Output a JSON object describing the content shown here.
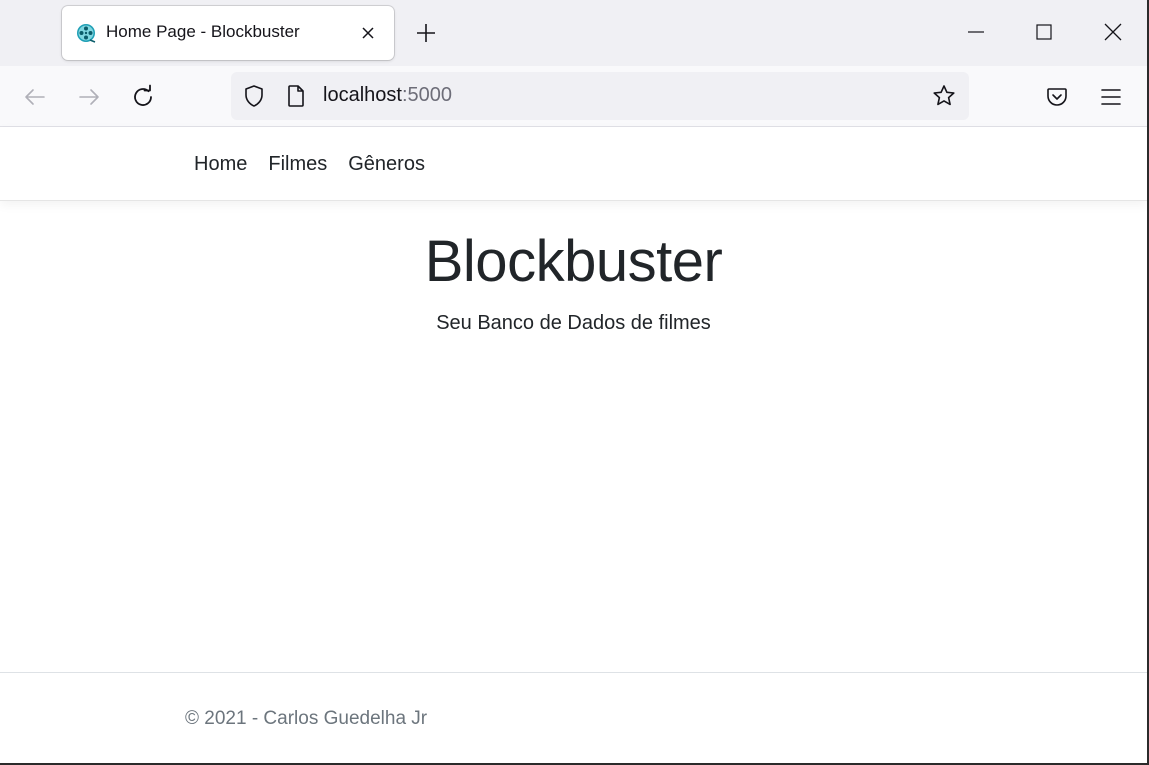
{
  "browser": {
    "tab": {
      "title": "Home Page - Blockbuster"
    },
    "url": {
      "host": "localhost",
      "port": ":5000"
    },
    "icons": {
      "favicon": "film-reel-icon",
      "close": "close-icon",
      "new_tab": "plus-icon",
      "back": "arrow-left-icon",
      "forward": "arrow-right-icon",
      "reload": "reload-icon",
      "shield": "shield-icon",
      "page": "page-icon",
      "bookmark": "star-icon",
      "pocket": "pocket-icon",
      "menu": "hamburger-menu-icon"
    },
    "colors": {
      "tabstrip": "#f0f0f4",
      "toolbar": "#f9f9fb"
    }
  },
  "site": {
    "nav": {
      "items": [
        {
          "label": "Home"
        },
        {
          "label": "Filmes"
        },
        {
          "label": "Gêneros"
        }
      ]
    },
    "hero": {
      "title": "Blockbuster",
      "subtitle": "Seu Banco de Dados de filmes"
    },
    "footer": {
      "text": "© 2021 - Carlos Guedelha Jr"
    }
  }
}
